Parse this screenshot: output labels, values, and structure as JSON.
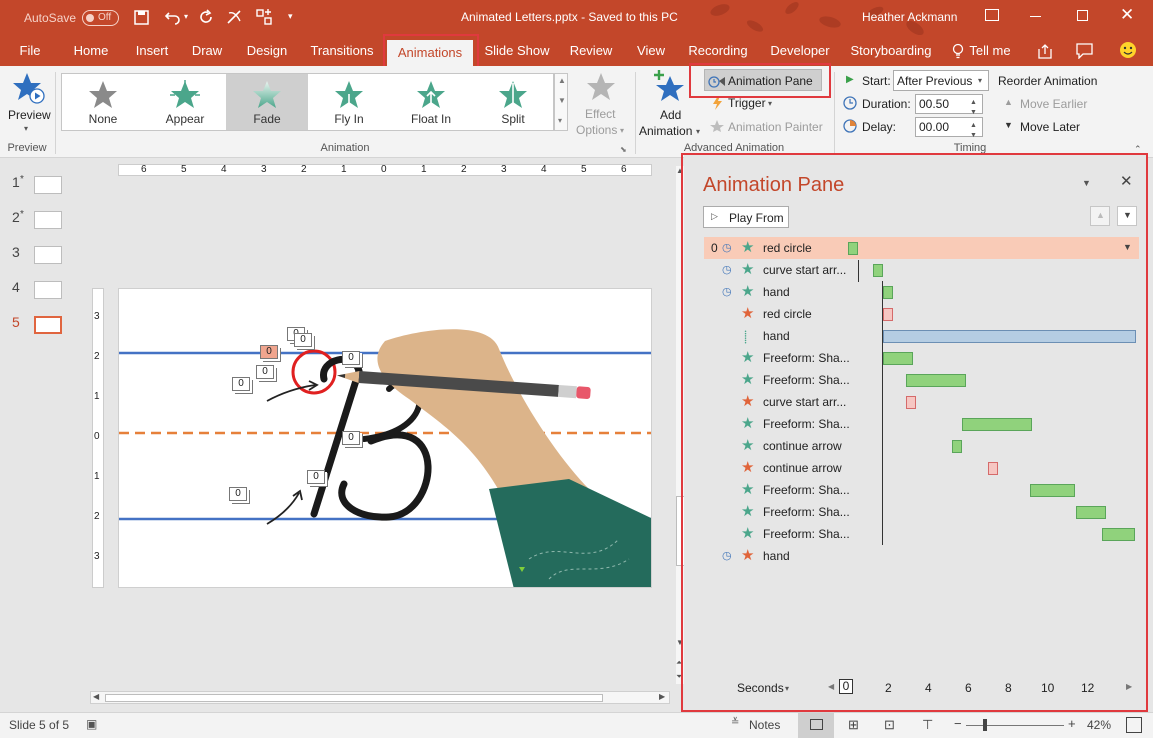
{
  "titlebar": {
    "autosave_label": "AutoSave",
    "autosave_state": "Off",
    "doc_title": "Animated Letters.pptx - Saved to this PC",
    "user": "Heather Ackmann"
  },
  "tabs": [
    "File",
    "Home",
    "Insert",
    "Draw",
    "Design",
    "Transitions",
    "Animations",
    "Slide Show",
    "Review",
    "View",
    "Recording",
    "Developer",
    "Storyboarding"
  ],
  "tell_me": "Tell me",
  "active_tab": "Animations",
  "ribbon": {
    "preview_label": "Preview",
    "preview_group": "Preview",
    "gallery": [
      "None",
      "Appear",
      "Fade",
      "Fly In",
      "Float In",
      "Split"
    ],
    "selected_effect": "Fade",
    "effect_options": [
      "Effect",
      "Options"
    ],
    "animation_group": "Animation",
    "add_animation": [
      "Add",
      "Animation"
    ],
    "animation_pane_btn": "Animation Pane",
    "trigger_btn": "Trigger",
    "animation_painter_btn": "Animation Painter",
    "advanced_group": "Advanced Animation",
    "start_label": "Start:",
    "start_value": "After Previous",
    "duration_label": "Duration:",
    "duration_value": "00.50",
    "delay_label": "Delay:",
    "delay_value": "00.00",
    "timing_group": "Timing",
    "reorder_label": "Reorder Animation",
    "move_earlier": "Move Earlier",
    "move_later": "Move Later"
  },
  "thumbnails": [
    "1",
    "2",
    "3",
    "4",
    "5"
  ],
  "active_slide": "5",
  "ruler_h_ticks": [
    "6",
    "5",
    "4",
    "3",
    "2",
    "1",
    "0",
    "1",
    "2",
    "3",
    "4",
    "5",
    "6"
  ],
  "ruler_v_ticks": [
    "3",
    "2",
    "1",
    "0",
    "1",
    "2",
    "3"
  ],
  "slide_tags": [
    "0",
    "0",
    "0",
    "0",
    "0",
    "0",
    "0",
    "0",
    "0",
    "0",
    "0"
  ],
  "pane": {
    "title": "Animation Pane",
    "play_from": "Play From",
    "rows": [
      {
        "order": "0",
        "name": "red circle"
      },
      {
        "order": "",
        "name": "curve start arr..."
      },
      {
        "order": "",
        "name": "hand"
      },
      {
        "order": "",
        "name": "red circle"
      },
      {
        "order": "",
        "name": "hand"
      },
      {
        "order": "",
        "name": "Freeform: Sha..."
      },
      {
        "order": "",
        "name": "Freeform: Sha..."
      },
      {
        "order": "",
        "name": "curve start arr..."
      },
      {
        "order": "",
        "name": "Freeform: Sha..."
      },
      {
        "order": "",
        "name": "continue arrow"
      },
      {
        "order": "",
        "name": "continue arrow"
      },
      {
        "order": "",
        "name": "Freeform: Sha..."
      },
      {
        "order": "",
        "name": "Freeform: Sha..."
      },
      {
        "order": "",
        "name": "Freeform: Sha..."
      },
      {
        "order": "",
        "name": "hand"
      }
    ],
    "seconds_label": "Seconds",
    "timeline_ticks": [
      "0",
      "2",
      "4",
      "6",
      "8",
      "10",
      "12"
    ]
  },
  "status": {
    "slide_info": "Slide 5 of 5",
    "notes": "Notes",
    "zoom": "42%"
  },
  "colors": {
    "accent": "#c3472a",
    "highlight": "#e0393e",
    "green_bar": "#90d27c",
    "row_selected": "#f9cbb7"
  }
}
